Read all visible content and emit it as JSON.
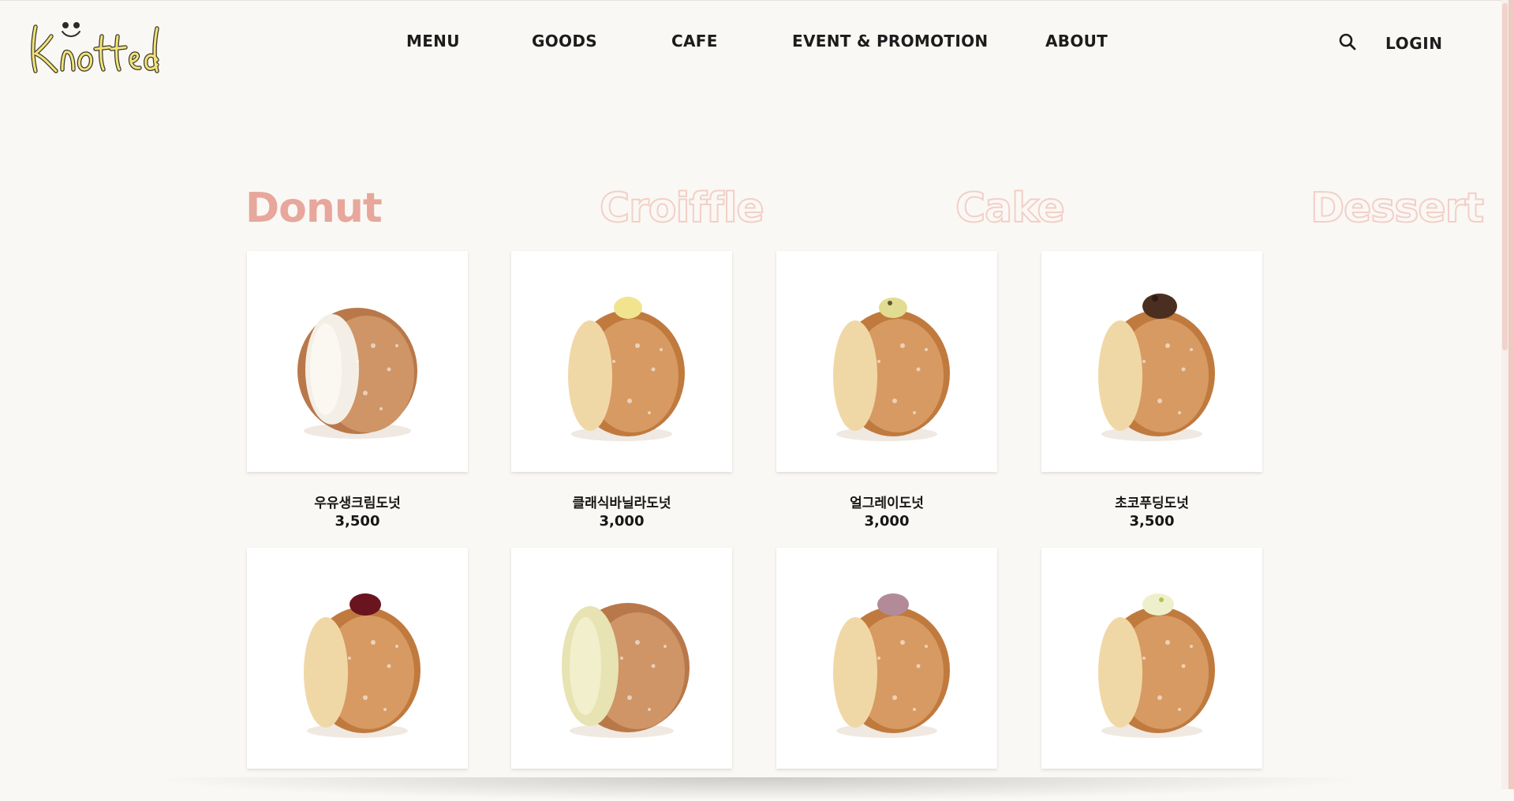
{
  "header": {
    "brand": "Knotted",
    "nav": [
      "MENU",
      "GOODS",
      "CAFE",
      "EVENT & PROMOTION",
      "ABOUT"
    ],
    "search_icon": "search-icon",
    "login_label": "LOGIN"
  },
  "categories": [
    {
      "label": "Donut",
      "active": true
    },
    {
      "label": "Croiffle",
      "active": false
    },
    {
      "label": "Cake",
      "active": false
    },
    {
      "label": "Dessert",
      "active": false
    }
  ],
  "products": [
    {
      "name": "우유생크림도넛",
      "price": "3,500",
      "topping": "cream-filled"
    },
    {
      "name": "클래식바닐라도넛",
      "price": "3,000",
      "topping": "vanilla"
    },
    {
      "name": "얼그레이도넛",
      "price": "3,000",
      "topping": "earl-grey"
    },
    {
      "name": "초코푸딩도넛",
      "price": "3,500",
      "topping": "chocolate"
    },
    {
      "name": "",
      "price": "",
      "topping": "raspberry"
    },
    {
      "name": "",
      "price": "",
      "topping": "matcha-cream"
    },
    {
      "name": "",
      "price": "",
      "topping": "berry"
    },
    {
      "name": "",
      "price": "",
      "topping": "lime"
    }
  ],
  "colors": {
    "background": "#faf8f4",
    "accent": "#e7a79c",
    "inactive_outline": "#f3cfc7",
    "logo": "#f3e27a"
  }
}
